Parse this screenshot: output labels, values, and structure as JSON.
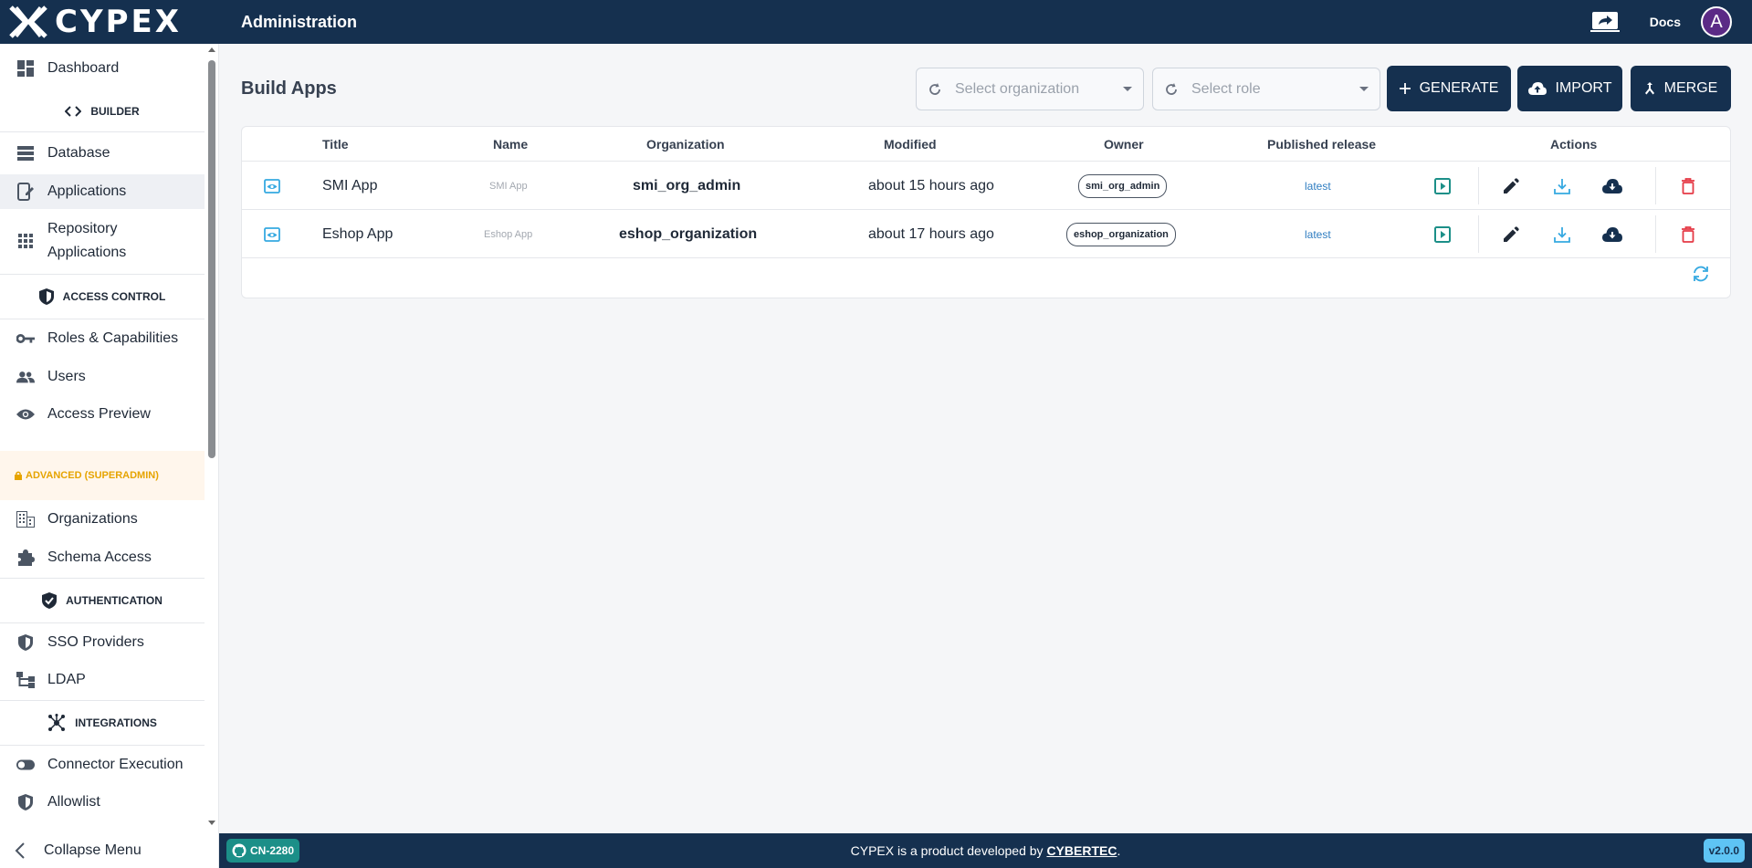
{
  "header": {
    "logo_text": "CYPEX",
    "title": "Administration",
    "docs_label": "Docs",
    "avatar_letter": "A"
  },
  "sidebar": {
    "dashboard": "Dashboard",
    "builder_section": "BUILDER",
    "database": "Database",
    "applications": "Applications",
    "repository_applications_line1": "Repository",
    "repository_applications_line2": "Applications",
    "access_control_section": "ACCESS CONTROL",
    "roles": "Roles & Capabilities",
    "users": "Users",
    "access_preview": "Access Preview",
    "advanced_section": "ADVANCED (SUPERADMIN)",
    "organizations": "Organizations",
    "schema_access": "Schema Access",
    "authentication_section": "AUTHENTICATION",
    "sso_providers": "SSO Providers",
    "ldap": "LDAP",
    "integrations_section": "INTEGRATIONS",
    "connector_execution": "Connector Execution",
    "allowlist": "Allowlist",
    "collapse": "Collapse Menu"
  },
  "main": {
    "page_title": "Build Apps",
    "select_org_placeholder": "Select organization",
    "select_role_placeholder": "Select role",
    "generate_label": "GENERATE",
    "import_label": "IMPORT",
    "merge_label": "MERGE"
  },
  "table": {
    "columns": {
      "title": "Title",
      "name": "Name",
      "organization": "Organization",
      "modified": "Modified",
      "owner": "Owner",
      "published_release": "Published release",
      "actions": "Actions"
    },
    "rows": [
      {
        "title": "SMI App",
        "name": "SMI App",
        "organization": "smi_org_admin",
        "modified": "about 15 hours ago",
        "owner": "smi_org_admin",
        "release": "latest"
      },
      {
        "title": "Eshop App",
        "name": "Eshop App",
        "organization": "eshop_organization",
        "modified": "about 17 hours ago",
        "owner": "eshop_organization",
        "release": "latest"
      }
    ]
  },
  "footer": {
    "build_tag": "CN-2280",
    "text_prefix": "CYPEX is a product developed by",
    "company": "CYBERTEC",
    "text_suffix": ".",
    "version": "v2.0.0"
  },
  "colors": {
    "navy": "#15304f",
    "teal": "#1c8f88",
    "light_blue": "#5ec4f4",
    "accent_blue": "#2f7dc1",
    "danger": "#e53945",
    "advanced": "#e6a400"
  }
}
